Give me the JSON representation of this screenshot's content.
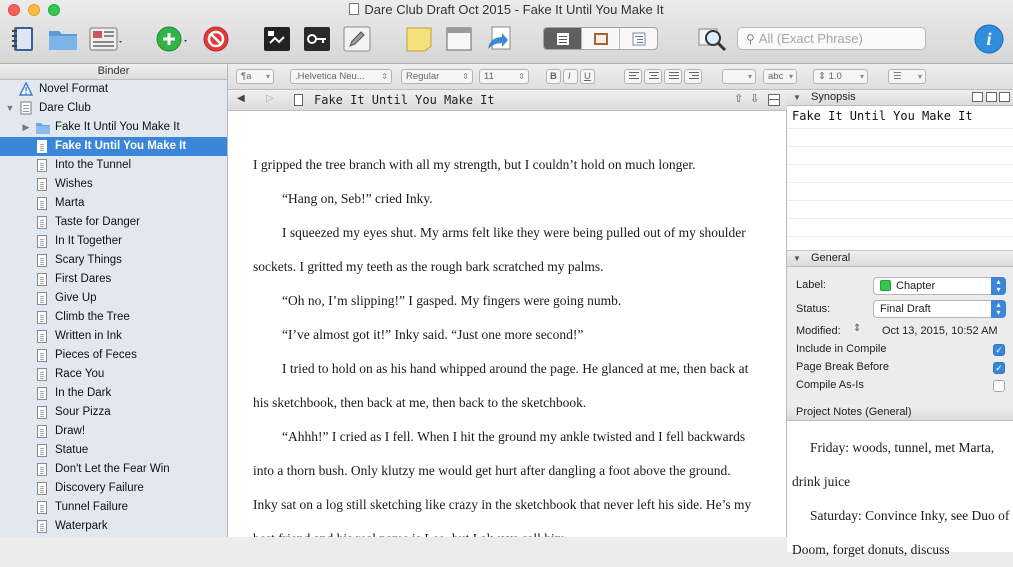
{
  "window": {
    "title": "Dare Club Draft Oct 2015 - Fake It Until You Make It"
  },
  "toolbar": {
    "buttons": [
      "binder-icon",
      "folder-icon",
      "view-grid-icon",
      "add-icon",
      "delete-icon",
      "quickref-icon",
      "keywords-icon",
      "edit-icon",
      "note-icon",
      "window-icon",
      "export-icon"
    ],
    "search_placeholder": "All (Exact Phrase)",
    "colors": {
      "add": "#32b34a",
      "delete": "#e23a3a",
      "info": "#2f8ede",
      "selection": "#3a86d8"
    }
  },
  "binder": {
    "header": "Binder",
    "items": [
      {
        "label": "Novel Format",
        "level": 0,
        "icon": "warning-icon",
        "disclosure": ""
      },
      {
        "label": "Dare Club",
        "level": 0,
        "icon": "draft-folder-icon",
        "disclosure": "▼"
      },
      {
        "label": "Fake It Until You Make It",
        "level": 1,
        "icon": "folder-icon",
        "disclosure": "▶"
      },
      {
        "label": "Fake It Until You Make It",
        "level": 1,
        "icon": "page-icon",
        "disclosure": "",
        "selected": true
      },
      {
        "label": "Into the Tunnel",
        "level": 1,
        "icon": "page-icon"
      },
      {
        "label": "Wishes",
        "level": 1,
        "icon": "page-icon"
      },
      {
        "label": "Marta",
        "level": 1,
        "icon": "page-icon"
      },
      {
        "label": "Taste for Danger",
        "level": 1,
        "icon": "page-icon"
      },
      {
        "label": "In It Together",
        "level": 1,
        "icon": "page-icon"
      },
      {
        "label": "Scary Things",
        "level": 1,
        "icon": "page-icon"
      },
      {
        "label": "First Dares",
        "level": 1,
        "icon": "page-icon"
      },
      {
        "label": "Give Up",
        "level": 1,
        "icon": "page-icon"
      },
      {
        "label": "Climb the Tree",
        "level": 1,
        "icon": "page-icon"
      },
      {
        "label": "Written in Ink",
        "level": 1,
        "icon": "page-icon"
      },
      {
        "label": "Pieces of Feces",
        "level": 1,
        "icon": "page-icon"
      },
      {
        "label": "Race You",
        "level": 1,
        "icon": "page-icon"
      },
      {
        "label": "In the Dark",
        "level": 1,
        "icon": "page-icon"
      },
      {
        "label": "Sour Pizza",
        "level": 1,
        "icon": "page-icon"
      },
      {
        "label": "Draw!",
        "level": 1,
        "icon": "page-icon"
      },
      {
        "label": "Statue",
        "level": 1,
        "icon": "page-icon"
      },
      {
        "label": "Don't Let the Fear Win",
        "level": 1,
        "icon": "page-icon"
      },
      {
        "label": "Discovery Failure",
        "level": 1,
        "icon": "page-icon"
      },
      {
        "label": "Tunnel Failure",
        "level": 1,
        "icon": "page-icon"
      },
      {
        "label": "Waterpark",
        "level": 1,
        "icon": "page-icon"
      }
    ]
  },
  "formatbar": {
    "style": "¶a",
    "font": ".Helvetica Neu...",
    "weight": "Regular",
    "size": "11",
    "bold": "B",
    "italic": "I",
    "underline": "U",
    "spacing": "1.0",
    "text_color_label": "abc"
  },
  "editor": {
    "title": "Fake It Until You Make It",
    "paragraphs": [
      "I gripped the tree branch with all my strength, but I couldn’t hold on much longer.",
      "“Hang on, Seb!” cried Inky.",
      "I squeezed my eyes shut. My arms felt like they were being pulled out of my shoulder sockets. I gritted my teeth as the rough bark scratched my palms.",
      "“Oh no, I’m slipping!” I gasped. My fingers were going numb.",
      "“I’ve almost got it!” Inky said. “Just one more second!”",
      "I tried to hold on as his hand whipped around the page. He glanced at me, then back at his sketchbook, then back at me, then back to the sketchbook.",
      "“Ahhh!” I cried as I fell. When I hit the ground my ankle twisted and I fell backwards into a thorn bush. Only klutzy me would get hurt after dangling a foot above the ground. Inky sat on a log still sketching like crazy in the sketchbook that never left his side. He’s my best friend and his real name is Leo, but I always call him"
    ]
  },
  "inspector": {
    "synopsis_header": "Synopsis",
    "synopsis_text": "Fake It Until You Make It",
    "general_header": "General",
    "label_label": "Label:",
    "label_value": "Chapter",
    "label_color": "#34c84a",
    "status_label": "Status:",
    "status_value": "Final Draft",
    "modified_label": "Modified:",
    "modified_value": "Oct 13, 2015, 10:52 AM",
    "include_label": "Include in Compile",
    "include_checked": true,
    "pagebreak_label": "Page Break Before",
    "pagebreak_checked": true,
    "compileas_label": "Compile As-Is",
    "compileas_checked": false,
    "notes_header": "Project Notes (General)",
    "notes": [
      "Friday: woods, tunnel, met Marta, drink juice",
      "Saturday: Convince Inky, see Duo of Doom, forget donuts, discuss"
    ]
  }
}
